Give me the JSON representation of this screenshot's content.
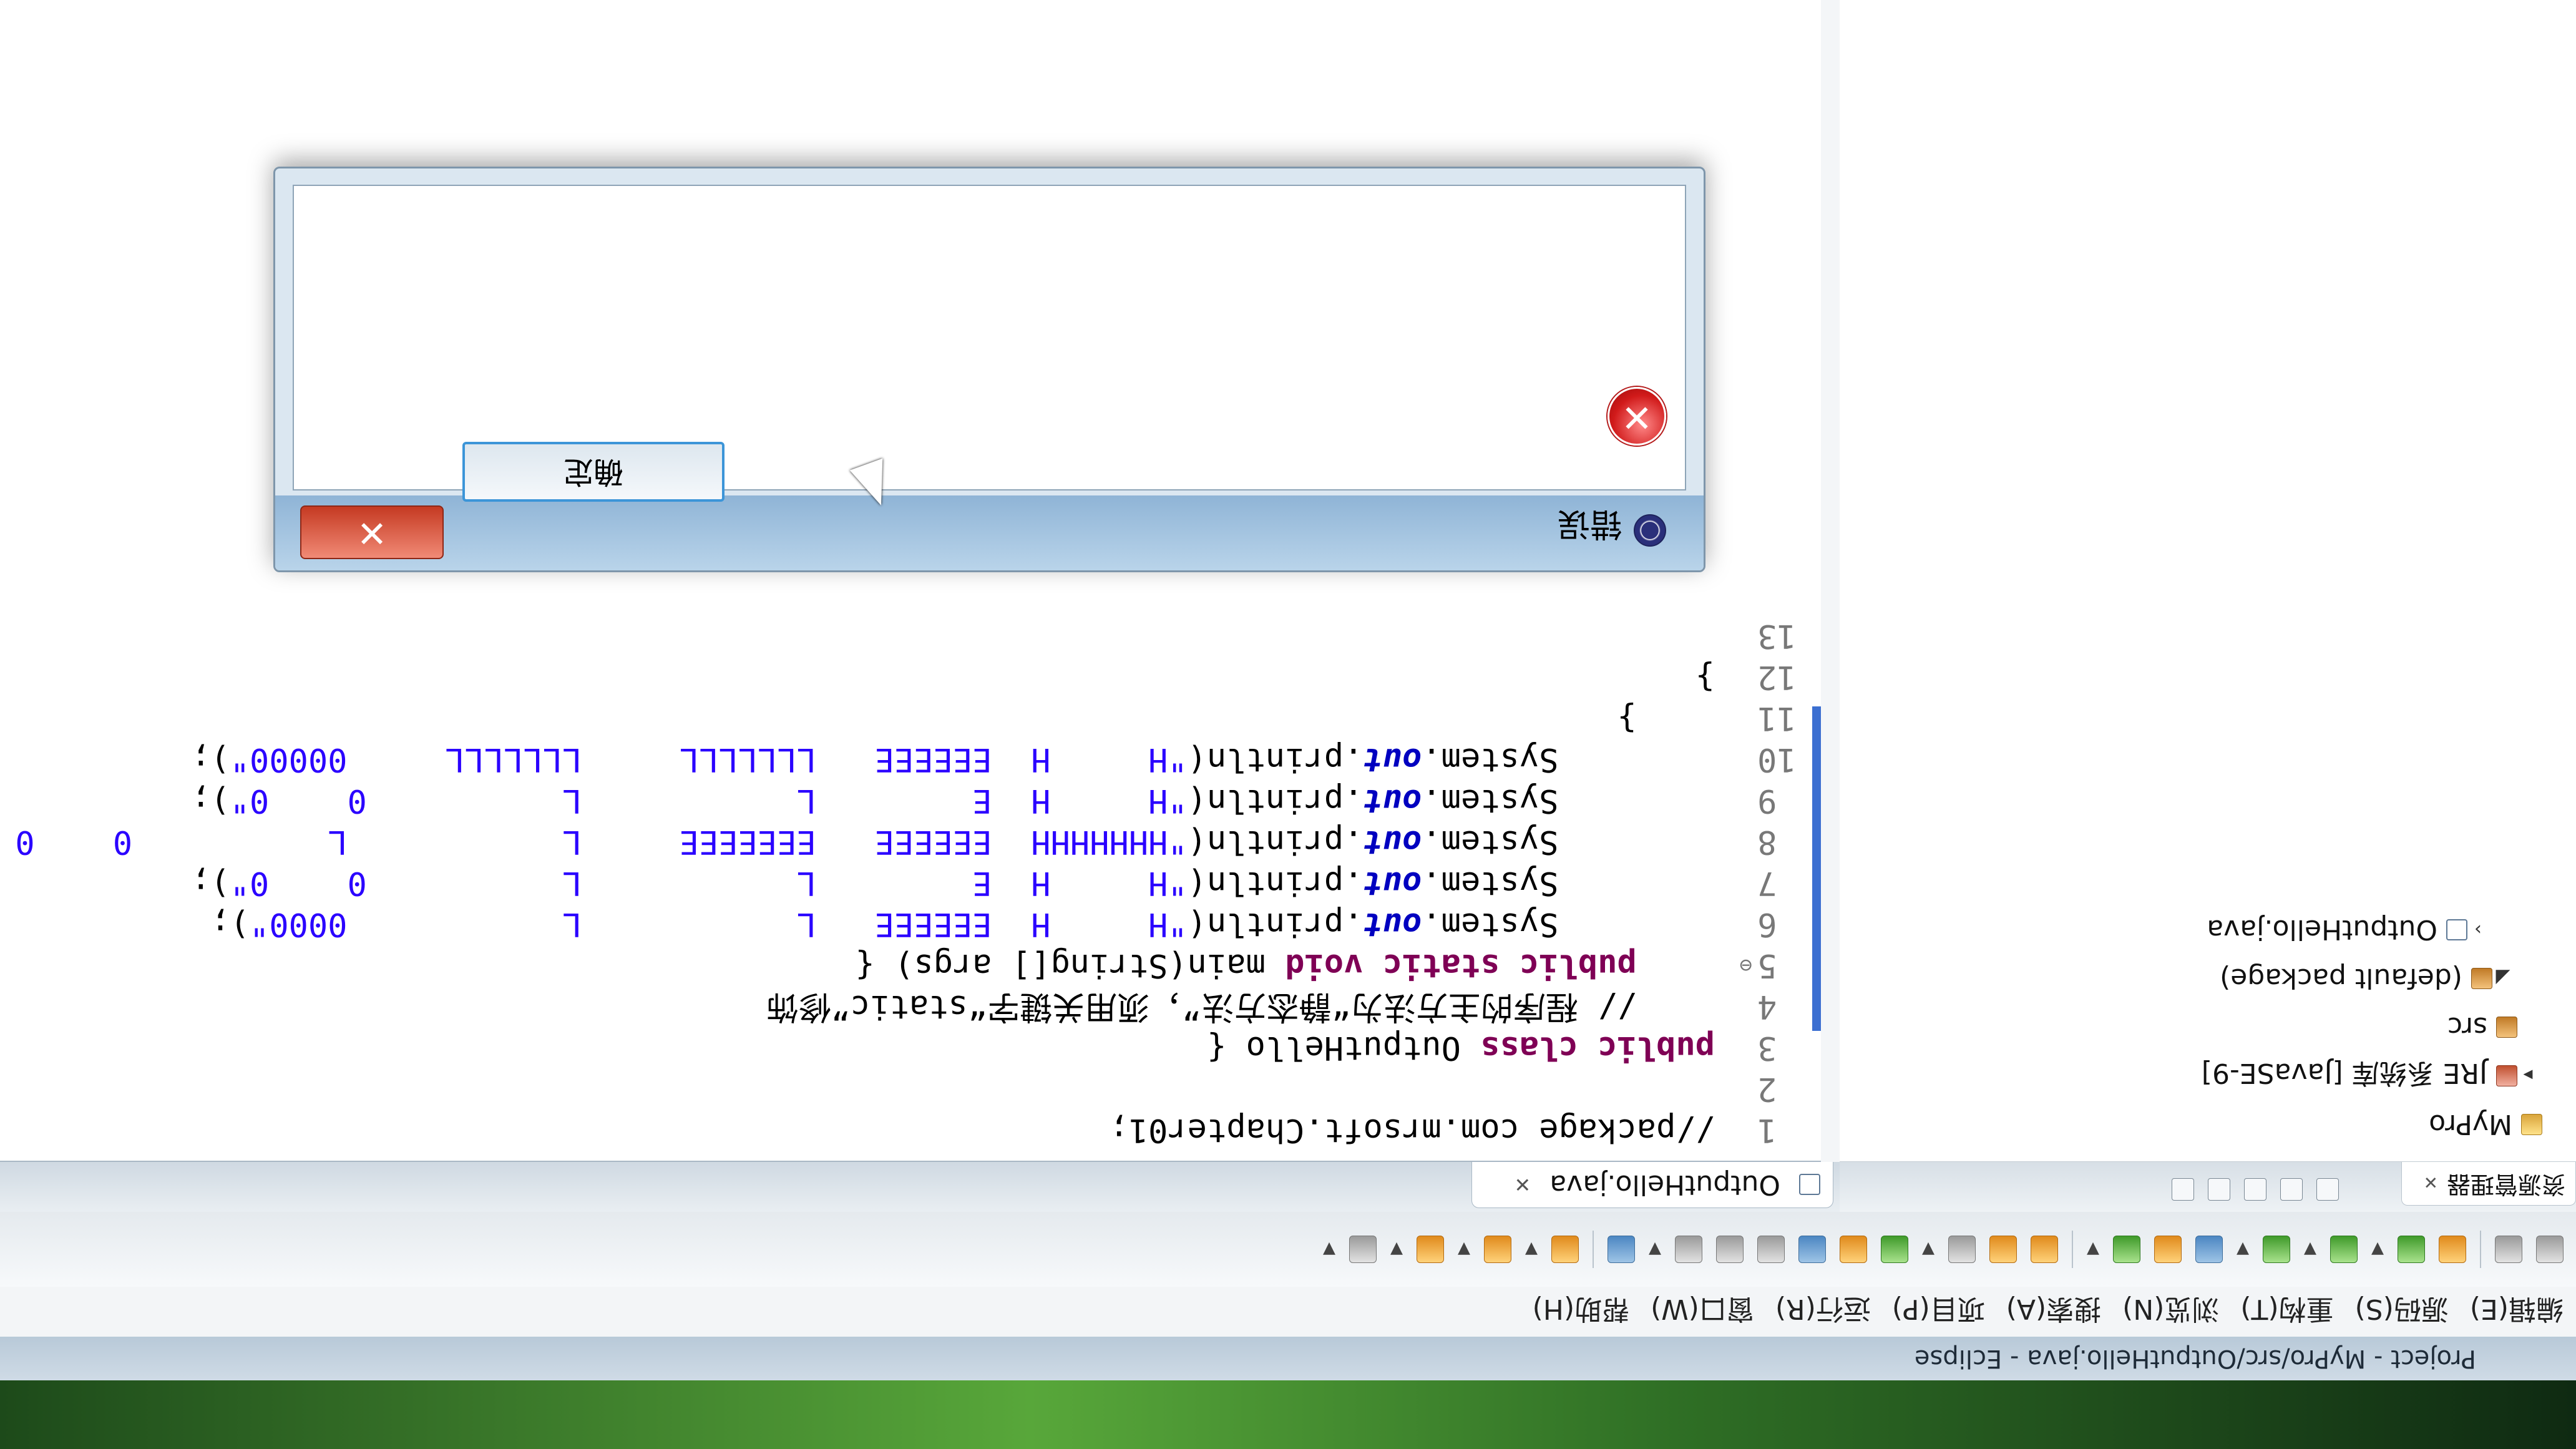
{
  "window": {
    "title": "Project - MyPro/src/OutputHello.java - Eclipse"
  },
  "menu": [
    "编辑(E)",
    "源码(S)",
    "重构(T)",
    "浏览(N)",
    "搜索(A)",
    "项目(P)",
    "运行(R)",
    "窗口(W)",
    "帮助(H)"
  ],
  "explorer": {
    "tab_label": "资源管理器",
    "close_glyph": "✕",
    "tree": [
      {
        "label": "MyPro",
        "icon": "project-icon",
        "indent": 0,
        "twisty": ""
      },
      {
        "label": "JRE 系统库 [JavaSE-9]",
        "icon": "library-icon",
        "indent": 1,
        "twisty": "▸"
      },
      {
        "label": "src",
        "icon": "source-folder-icon",
        "indent": 1,
        "twisty": ""
      },
      {
        "label": "(default package)",
        "icon": "package-icon",
        "indent": 2,
        "twisty": "◢"
      },
      {
        "label": "OutputHello.java",
        "icon": "java-file-icon",
        "indent": 3,
        "twisty": "›"
      }
    ]
  },
  "editor": {
    "tab_label": "OutputHello.java",
    "close_glyph": "✕",
    "lines": [
      {
        "n": "1",
        "fold": "",
        "parts": [
          {
            "t": "//package com.mrsoft.Chapter01;",
            "c": "plain"
          }
        ]
      },
      {
        "n": "2",
        "fold": "",
        "parts": []
      },
      {
        "n": "3",
        "fold": "",
        "parts": [
          {
            "t": "public class ",
            "c": "kw"
          },
          {
            "t": "OutputHello {",
            "c": "plain"
          }
        ]
      },
      {
        "n": "4",
        "fold": "",
        "parts": [
          {
            "t": "    // 程序的主方法为“静态方法”，须用关键字“static”修饰",
            "c": "plain"
          }
        ]
      },
      {
        "n": "5",
        "fold": "⊖",
        "parts": [
          {
            "t": "    public static void ",
            "c": "kw"
          },
          {
            "t": "main(String[] args) {",
            "c": "plain"
          }
        ]
      },
      {
        "n": "6",
        "fold": "",
        "parts": [
          {
            "t": "        System.",
            "c": "plain"
          },
          {
            "t": "out",
            "c": "fld"
          },
          {
            "t": ".println(",
            "c": "plain"
          },
          {
            "t": "\"H     H  EEEEEE   L           L           0000\"",
            "c": "str"
          },
          {
            "t": ");",
            "c": "plain"
          }
        ]
      },
      {
        "n": "7",
        "fold": "",
        "parts": [
          {
            "t": "        System.",
            "c": "plain"
          },
          {
            "t": "out",
            "c": "fld"
          },
          {
            "t": ".println(",
            "c": "plain"
          },
          {
            "t": "\"H     H  E        L           L          0    0\"",
            "c": "str"
          },
          {
            "t": ");",
            "c": "plain"
          }
        ]
      },
      {
        "n": "8",
        "fold": "",
        "parts": [
          {
            "t": "        System.",
            "c": "plain"
          },
          {
            "t": "out",
            "c": "fld"
          },
          {
            "t": ".println(",
            "c": "plain"
          },
          {
            "t": "\"HHHHHHH  EEEEEE   EEEEEEE     L           L          0    0 \"",
            "c": "str"
          },
          {
            "t": ");",
            "c": "plain"
          }
        ]
      },
      {
        "n": "9",
        "fold": "",
        "parts": [
          {
            "t": "        System.",
            "c": "plain"
          },
          {
            "t": "out",
            "c": "fld"
          },
          {
            "t": ".println(",
            "c": "plain"
          },
          {
            "t": "\"H     H  E        L           L          0    0\"",
            "c": "str"
          },
          {
            "t": ");",
            "c": "plain"
          }
        ]
      },
      {
        "n": "10",
        "fold": "",
        "parts": [
          {
            "t": "        System.",
            "c": "plain"
          },
          {
            "t": "out",
            "c": "fld"
          },
          {
            "t": ".println(",
            "c": "plain"
          },
          {
            "t": "\"H     H  EEEEEE   LLLLLLL     LLLLLLL     00000\"",
            "c": "str"
          },
          {
            "t": ");",
            "c": "plain"
          }
        ]
      },
      {
        "n": "11",
        "fold": "",
        "parts": [
          {
            "t": "    }",
            "c": "plain"
          }
        ]
      },
      {
        "n": "12",
        "fold": "",
        "parts": [
          {
            "t": "}",
            "c": "plain"
          }
        ]
      },
      {
        "n": "13",
        "fold": "",
        "parts": []
      }
    ]
  },
  "dialog": {
    "title": "错误",
    "close_glyph": "✕",
    "error_glyph": "✕",
    "ok_label": "确定"
  }
}
